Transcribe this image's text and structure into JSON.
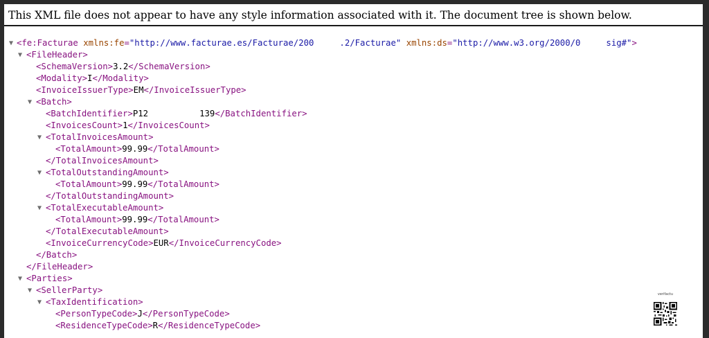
{
  "info": "This XML file does not appear to have any style information associated with it. The document tree is shown below.",
  "tree": {
    "root_open": "<fe:Facturae",
    "ns_fe_attr": "xmlns:fe",
    "ns_fe_value": "\"http://www.facturae.es/Facturae/200     .2/Facturae\"",
    "ns_ds_attr": "xmlns:ds",
    "ns_ds_value": "\"http://www.w3.org/2000/0     sig#\"",
    "root_close_bracket": ">",
    "file_header_open": "<FileHeader>",
    "schema_version_open": "<SchemaVersion>",
    "schema_version_value": "3.2",
    "schema_version_close": "</SchemaVersion>",
    "modality_open": "<Modality>",
    "modality_value": "I",
    "modality_close": "</Modality>",
    "issuer_type_open": "<InvoiceIssuerType>",
    "issuer_type_value": "EM",
    "issuer_type_close": "</InvoiceIssuerType>",
    "batch_open": "<Batch>",
    "batch_id_open": "<BatchIdentifier>",
    "batch_id_value": "P12          139",
    "batch_id_close": "</BatchIdentifier>",
    "invoices_count_open": "<InvoicesCount>",
    "invoices_count_value": "1",
    "invoices_count_close": "</InvoicesCount>",
    "total_invoices_open": "<TotalInvoicesAmount>",
    "total_amount_open": "<TotalAmount>",
    "total_invoices_amount_value": "99.99",
    "total_amount_close": "</TotalAmount>",
    "total_invoices_close": "</TotalInvoicesAmount>",
    "total_outstanding_open": "<TotalOutstandingAmount>",
    "total_outstanding_amount_value": "99.99",
    "total_outstanding_close": "</TotalOutstandingAmount>",
    "total_executable_open": "<TotalExecutableAmount>",
    "total_executable_amount_value": "99.99",
    "total_executable_close": "</TotalExecutableAmount>",
    "currency_open": "<InvoiceCurrencyCode>",
    "currency_value": "EUR",
    "currency_close": "</InvoiceCurrencyCode>",
    "batch_close": "</Batch>",
    "file_header_close": "</FileHeader>",
    "parties_open": "<Parties>",
    "seller_open": "<SellerParty>",
    "tax_id_open": "<TaxIdentification>",
    "person_type_open": "<PersonTypeCode>",
    "person_type_value": "J",
    "person_type_close": "</PersonTypeCode>",
    "residence_type_open": "<ResidenceTypeCode>",
    "residence_type_value": "R",
    "residence_type_close": "</ResidenceTypeCode>",
    "toggle_glyph": "▼"
  },
  "qr": {
    "caption": "verifactu"
  },
  "colors": {
    "tag": "#881280",
    "attr_name": "#994500",
    "attr_value": "#1a1aa6",
    "background": "#2b2b2b"
  }
}
